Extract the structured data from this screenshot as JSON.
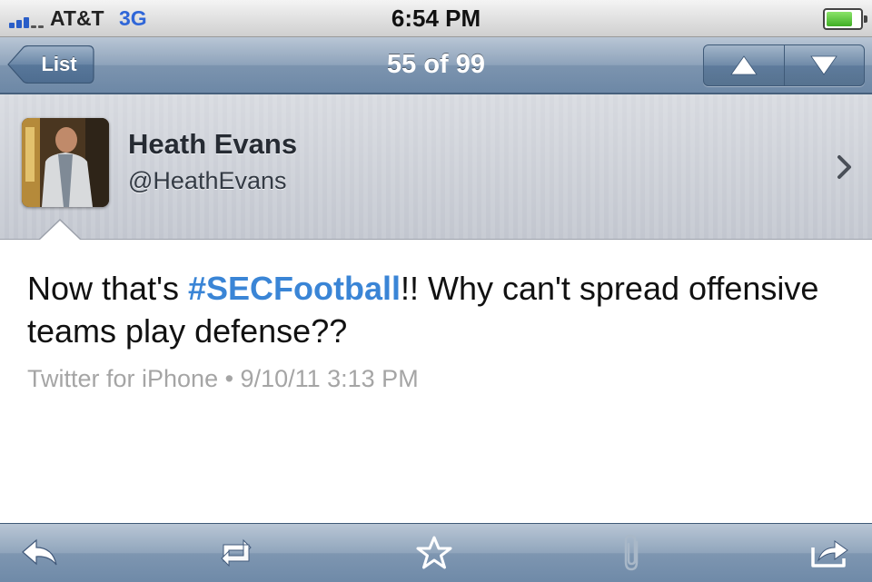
{
  "status_bar": {
    "carrier": "AT&T",
    "network": "3G",
    "time": "6:54 PM"
  },
  "nav": {
    "back_label": "List",
    "title": "55 of 99"
  },
  "profile": {
    "name": "Heath Evans",
    "handle": "@HeathEvans"
  },
  "tweet": {
    "text_before": "Now that's ",
    "hashtag": "#SECFootball",
    "text_after": "!! Why can't spread offensive teams play defense??",
    "meta": "Twitter for iPhone • 9/10/11 3:13 PM"
  },
  "toolbar": {
    "icons": [
      "reply-icon",
      "retweet-icon",
      "favorite-icon",
      "attachment-icon",
      "share-icon"
    ]
  },
  "colors": {
    "hashtag": "#3a85d6",
    "navbar": "#7c94af",
    "meta_text": "#a5a5a5"
  }
}
